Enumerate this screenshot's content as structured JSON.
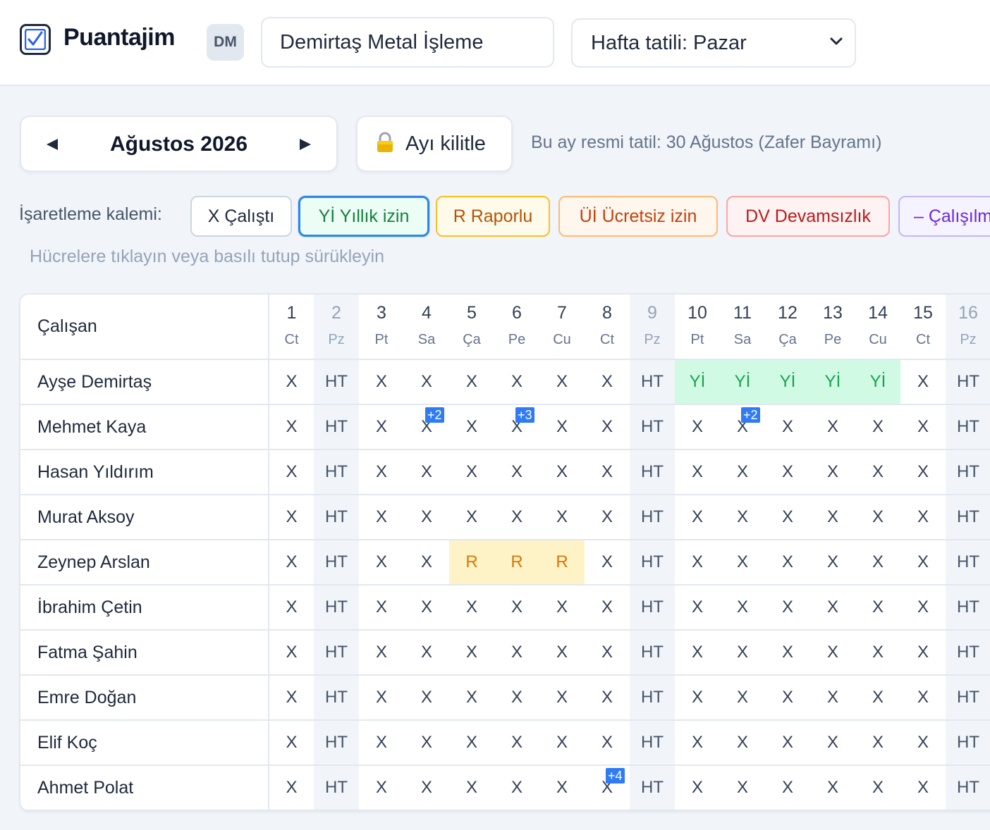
{
  "app": {
    "title": "Puantajim",
    "avatar_initials": "DM"
  },
  "company": {
    "value": "Demirtaş Metal İşleme",
    "placeholder": ""
  },
  "weekly_holiday": {
    "selected": "Hafta tatili: Pazar"
  },
  "month_nav": {
    "label": "Ağustos 2026"
  },
  "lock_button": {
    "label": "Ayı kilitle"
  },
  "holiday_note": "Bu ay resmi tatil: 30 Ağustos (Zafer Bayramı)",
  "marker": {
    "label": "İşaretleme kalemi:",
    "chips": [
      {
        "code": "X",
        "label": "X Çalıştı"
      },
      {
        "code": "Yİ",
        "label": "Yİ Yıllık izin"
      },
      {
        "code": "R",
        "label": "R Raporlu"
      },
      {
        "code": "Üİ",
        "label": "Üİ Ücretsiz izin"
      },
      {
        "code": "DV",
        "label": "DV Devamsızlık"
      },
      {
        "code": "–",
        "label": "– Çalışılma"
      }
    ],
    "selected": "Yİ"
  },
  "hint": "Hücrelere tıklayın veya basılı tutup sürükleyin",
  "table": {
    "name_header": "Çalışan",
    "days": [
      {
        "num": "1",
        "name": "Ct",
        "weekend": false
      },
      {
        "num": "2",
        "name": "Pz",
        "weekend": true
      },
      {
        "num": "3",
        "name": "Pt",
        "weekend": false
      },
      {
        "num": "4",
        "name": "Sa",
        "weekend": false
      },
      {
        "num": "5",
        "name": "Ça",
        "weekend": false
      },
      {
        "num": "6",
        "name": "Pe",
        "weekend": false
      },
      {
        "num": "7",
        "name": "Cu",
        "weekend": false
      },
      {
        "num": "8",
        "name": "Ct",
        "weekend": false
      },
      {
        "num": "9",
        "name": "Pz",
        "weekend": true
      },
      {
        "num": "10",
        "name": "Pt",
        "weekend": false
      },
      {
        "num": "11",
        "name": "Sa",
        "weekend": false
      },
      {
        "num": "12",
        "name": "Ça",
        "weekend": false
      },
      {
        "num": "13",
        "name": "Pe",
        "weekend": false
      },
      {
        "num": "14",
        "name": "Cu",
        "weekend": false
      },
      {
        "num": "15",
        "name": "Ct",
        "weekend": false
      },
      {
        "num": "16",
        "name": "Pz",
        "weekend": true
      }
    ],
    "rows": [
      {
        "name": "Ayşe Demirtaş",
        "cells": [
          "X",
          "HT",
          "X",
          "X",
          "X",
          "X",
          "X",
          "X",
          "HT",
          "Yİ",
          "Yİ",
          "Yİ",
          "Yİ",
          "Yİ",
          "X",
          "HT"
        ],
        "badges": {}
      },
      {
        "name": "Mehmet Kaya",
        "cells": [
          "X",
          "HT",
          "X",
          "X",
          "X",
          "X",
          "X",
          "X",
          "HT",
          "X",
          "X",
          "X",
          "X",
          "X",
          "X",
          "HT"
        ],
        "badges": {
          "3": "+2",
          "5": "+3",
          "10": "+2"
        }
      },
      {
        "name": "Hasan Yıldırım",
        "cells": [
          "X",
          "HT",
          "X",
          "X",
          "X",
          "X",
          "X",
          "X",
          "HT",
          "X",
          "X",
          "X",
          "X",
          "X",
          "X",
          "HT"
        ],
        "badges": {}
      },
      {
        "name": "Murat Aksoy",
        "cells": [
          "X",
          "HT",
          "X",
          "X",
          "X",
          "X",
          "X",
          "X",
          "HT",
          "X",
          "X",
          "X",
          "X",
          "X",
          "X",
          "HT"
        ],
        "badges": {}
      },
      {
        "name": "Zeynep Arslan",
        "cells": [
          "X",
          "HT",
          "X",
          "X",
          "R",
          "R",
          "R",
          "X",
          "HT",
          "X",
          "X",
          "X",
          "X",
          "X",
          "X",
          "HT"
        ],
        "badges": {}
      },
      {
        "name": "İbrahim Çetin",
        "cells": [
          "X",
          "HT",
          "X",
          "X",
          "X",
          "X",
          "X",
          "X",
          "HT",
          "X",
          "X",
          "X",
          "X",
          "X",
          "X",
          "HT"
        ],
        "badges": {}
      },
      {
        "name": "Fatma Şahin",
        "cells": [
          "X",
          "HT",
          "X",
          "X",
          "X",
          "X",
          "X",
          "X",
          "HT",
          "X",
          "X",
          "X",
          "X",
          "X",
          "X",
          "HT"
        ],
        "badges": {}
      },
      {
        "name": "Emre Doğan",
        "cells": [
          "X",
          "HT",
          "X",
          "X",
          "X",
          "X",
          "X",
          "X",
          "HT",
          "X",
          "X",
          "X",
          "X",
          "X",
          "X",
          "HT"
        ],
        "badges": {}
      },
      {
        "name": "Elif Koç",
        "cells": [
          "X",
          "HT",
          "X",
          "X",
          "X",
          "X",
          "X",
          "X",
          "HT",
          "X",
          "X",
          "X",
          "X",
          "X",
          "X",
          "HT"
        ],
        "badges": {}
      },
      {
        "name": "Ahmet Polat",
        "cells": [
          "X",
          "HT",
          "X",
          "X",
          "X",
          "X",
          "X",
          "X",
          "HT",
          "X",
          "X",
          "X",
          "X",
          "X",
          "X",
          "HT"
        ],
        "badges": {
          "7": "+4"
        }
      }
    ]
  },
  "colors": {
    "accent": "#2f7bf6",
    "worked": "#334155",
    "annual_leave_bg": "#d1fae5",
    "report_bg": "#fef3c7",
    "weekend_bg": "#f1f5f9"
  },
  "icons": {
    "logo": "checkbox-check-icon",
    "prev": "triangle-left-icon",
    "next": "triangle-right-icon",
    "lock": "padlock-icon",
    "select": "chevron-down-icon"
  }
}
